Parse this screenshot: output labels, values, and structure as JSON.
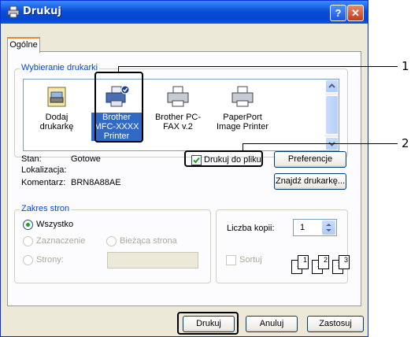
{
  "window": {
    "title": "Drukuj",
    "help": "?",
    "close": "✕"
  },
  "tab": {
    "label": "Ogólne"
  },
  "printer_group": {
    "legend": "Wybieranie drukarki",
    "printers": [
      {
        "label": "Dodaj drukarkę",
        "icon": "add-printer-icon",
        "selected": false
      },
      {
        "label": "Brother MFC-XXXX Printer",
        "icon": "printer-icon",
        "selected": true
      },
      {
        "label": "Brother PC-FAX v.2",
        "icon": "fax-printer-icon",
        "selected": false
      },
      {
        "label": "PaperPort Image Printer",
        "icon": "printer-icon",
        "selected": false
      }
    ],
    "status_label": "Stan:",
    "status_value": "Gotowe",
    "location_label": "Lokalizacja:",
    "location_value": "",
    "comment_label": "Komentarz:",
    "comment_value": "BRN8A88AE",
    "print_to_file_label": "Drukuj do pliku",
    "print_to_file_checked": true,
    "preferences_button": "Preferencje",
    "find_printer_button": "Znajdź drukarkę..."
  },
  "range_group": {
    "legend": "Zakres stron",
    "all": "Wszystko",
    "selection": "Zaznaczenie",
    "current_page": "Bieżąca strona",
    "pages": "Strony:",
    "pages_value": ""
  },
  "copies": {
    "label": "Liczba kopii:",
    "value": "1",
    "collate": "Sortuj",
    "pages": [
      "1",
      "1",
      "2",
      "2",
      "3",
      "3"
    ]
  },
  "buttons": {
    "print": "Drukuj",
    "cancel": "Anuluj",
    "apply": "Zastosuj"
  },
  "callouts": {
    "one": "1",
    "two": "2"
  },
  "colors": {
    "title_bar": "#0a4fd6",
    "legend_text": "#0046d5",
    "selected": "#316ac5"
  }
}
